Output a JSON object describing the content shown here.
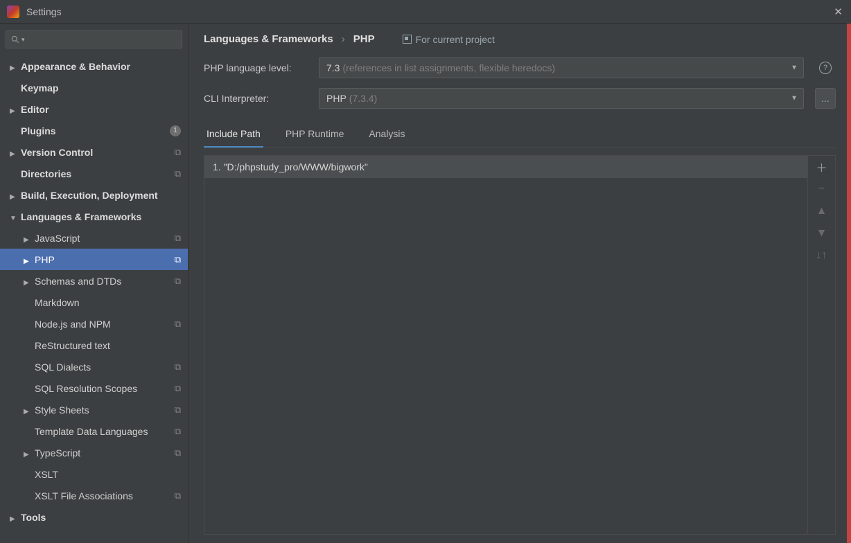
{
  "window": {
    "title": "Settings"
  },
  "breadcrumb": {
    "parent": "Languages & Frameworks",
    "current": "PHP",
    "scope": "For current project"
  },
  "sidebar": {
    "items": [
      {
        "label": "Appearance & Behavior",
        "depth": 0,
        "arrow": "collapsed",
        "bold": true
      },
      {
        "label": "Keymap",
        "depth": 0,
        "arrow": "none",
        "bold": true
      },
      {
        "label": "Editor",
        "depth": 0,
        "arrow": "collapsed",
        "bold": true
      },
      {
        "label": "Plugins",
        "depth": 0,
        "arrow": "none",
        "bold": true,
        "count": "1"
      },
      {
        "label": "Version Control",
        "depth": 0,
        "arrow": "collapsed",
        "bold": true,
        "proj": true
      },
      {
        "label": "Directories",
        "depth": 0,
        "arrow": "none",
        "bold": true,
        "proj": true
      },
      {
        "label": "Build, Execution, Deployment",
        "depth": 0,
        "arrow": "collapsed",
        "bold": true
      },
      {
        "label": "Languages & Frameworks",
        "depth": 0,
        "arrow": "expanded",
        "bold": true
      },
      {
        "label": "JavaScript",
        "depth": 1,
        "arrow": "collapsed",
        "proj": true
      },
      {
        "label": "PHP",
        "depth": 1,
        "arrow": "collapsed",
        "proj": true,
        "selected": true
      },
      {
        "label": "Schemas and DTDs",
        "depth": 1,
        "arrow": "collapsed",
        "proj": true
      },
      {
        "label": "Markdown",
        "depth": 1,
        "arrow": "none"
      },
      {
        "label": "Node.js and NPM",
        "depth": 1,
        "arrow": "none",
        "proj": true
      },
      {
        "label": "ReStructured text",
        "depth": 1,
        "arrow": "none"
      },
      {
        "label": "SQL Dialects",
        "depth": 1,
        "arrow": "none",
        "proj": true
      },
      {
        "label": "SQL Resolution Scopes",
        "depth": 1,
        "arrow": "none",
        "proj": true
      },
      {
        "label": "Style Sheets",
        "depth": 1,
        "arrow": "collapsed",
        "proj": true
      },
      {
        "label": "Template Data Languages",
        "depth": 1,
        "arrow": "none",
        "proj": true
      },
      {
        "label": "TypeScript",
        "depth": 1,
        "arrow": "collapsed",
        "proj": true
      },
      {
        "label": "XSLT",
        "depth": 1,
        "arrow": "none"
      },
      {
        "label": "XSLT File Associations",
        "depth": 1,
        "arrow": "none",
        "proj": true
      },
      {
        "label": "Tools",
        "depth": 0,
        "arrow": "collapsed",
        "bold": true
      }
    ]
  },
  "form": {
    "lang_level_label": "PHP language level:",
    "lang_level_value": "7.3",
    "lang_level_hint": "(references in list assignments, flexible heredocs)",
    "cli_label": "CLI Interpreter:",
    "cli_value": "PHP",
    "cli_hint": "(7.3.4)"
  },
  "tabs": {
    "items": [
      "Include Path",
      "PHP Runtime",
      "Analysis"
    ],
    "active": 0
  },
  "include_paths": {
    "rows": [
      "1.  \"D:/phpstudy_pro/WWW/bigwork\""
    ]
  },
  "tools": {
    "more": "...",
    "help": "?"
  }
}
